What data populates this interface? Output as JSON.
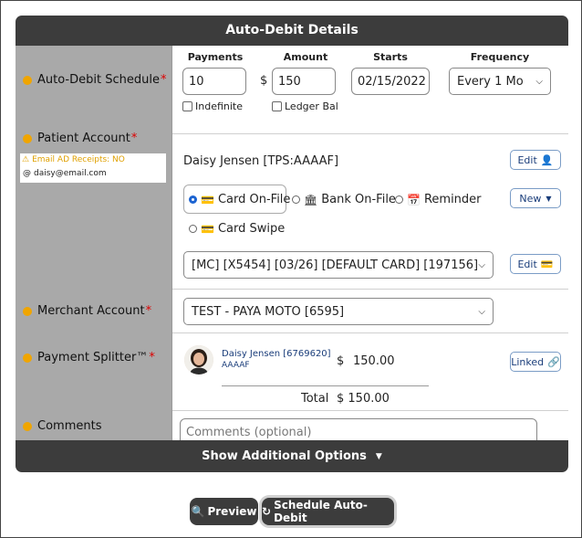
{
  "header": {
    "title": "Auto-Debit Details"
  },
  "schedule": {
    "label": "Auto-Debit Schedule",
    "payments_label": "Payments",
    "payments_value": "10",
    "amount_label": "Amount",
    "currency": "$",
    "amount_value": "150",
    "starts_label": "Starts",
    "starts_value": "02/15/2022",
    "frequency_label": "Frequency",
    "frequency_value": "Every 1 Mo",
    "indefinite_label": "Indefinite",
    "ledger_label": "Ledger Bal"
  },
  "patient": {
    "label": "Patient Account",
    "email_warning": "Email AD Receipts: NO",
    "email": "daisy@email.com",
    "name": "Daisy Jensen [TPS:AAAAF]",
    "edit_label": "Edit",
    "new_label": "New",
    "options": [
      {
        "label": "Card On-File",
        "selected": true
      },
      {
        "label": "Bank On-File",
        "selected": false
      },
      {
        "label": "Reminder",
        "selected": false
      },
      {
        "label": "Card Swipe",
        "selected": false
      }
    ],
    "card_value": "[MC] [X5454] [03/26] [DEFAULT CARD] [197156]",
    "card_edit_label": "Edit"
  },
  "merchant": {
    "label": "Merchant Account",
    "value": "TEST - PAYA MOTO [6595]"
  },
  "splitter": {
    "label": "Payment Splitter™",
    "person_name": "Daisy Jensen [6769620]",
    "person_code": "AAAAF",
    "currency": "$",
    "amount": "150.00",
    "linked_label": "Linked",
    "total_label": "Total",
    "total_value": "$ 150.00"
  },
  "comments": {
    "label": "Comments",
    "placeholder": "Comments (optional)"
  },
  "additional": {
    "label": "Show Additional Options"
  },
  "actions": {
    "preview": "Preview",
    "schedule": "Schedule Auto-Debit"
  },
  "colors": {
    "dark": "#3c3c3c",
    "label_bg": "#a9a9a9",
    "accent": "#f0a500",
    "link": "#1a3d7a"
  }
}
